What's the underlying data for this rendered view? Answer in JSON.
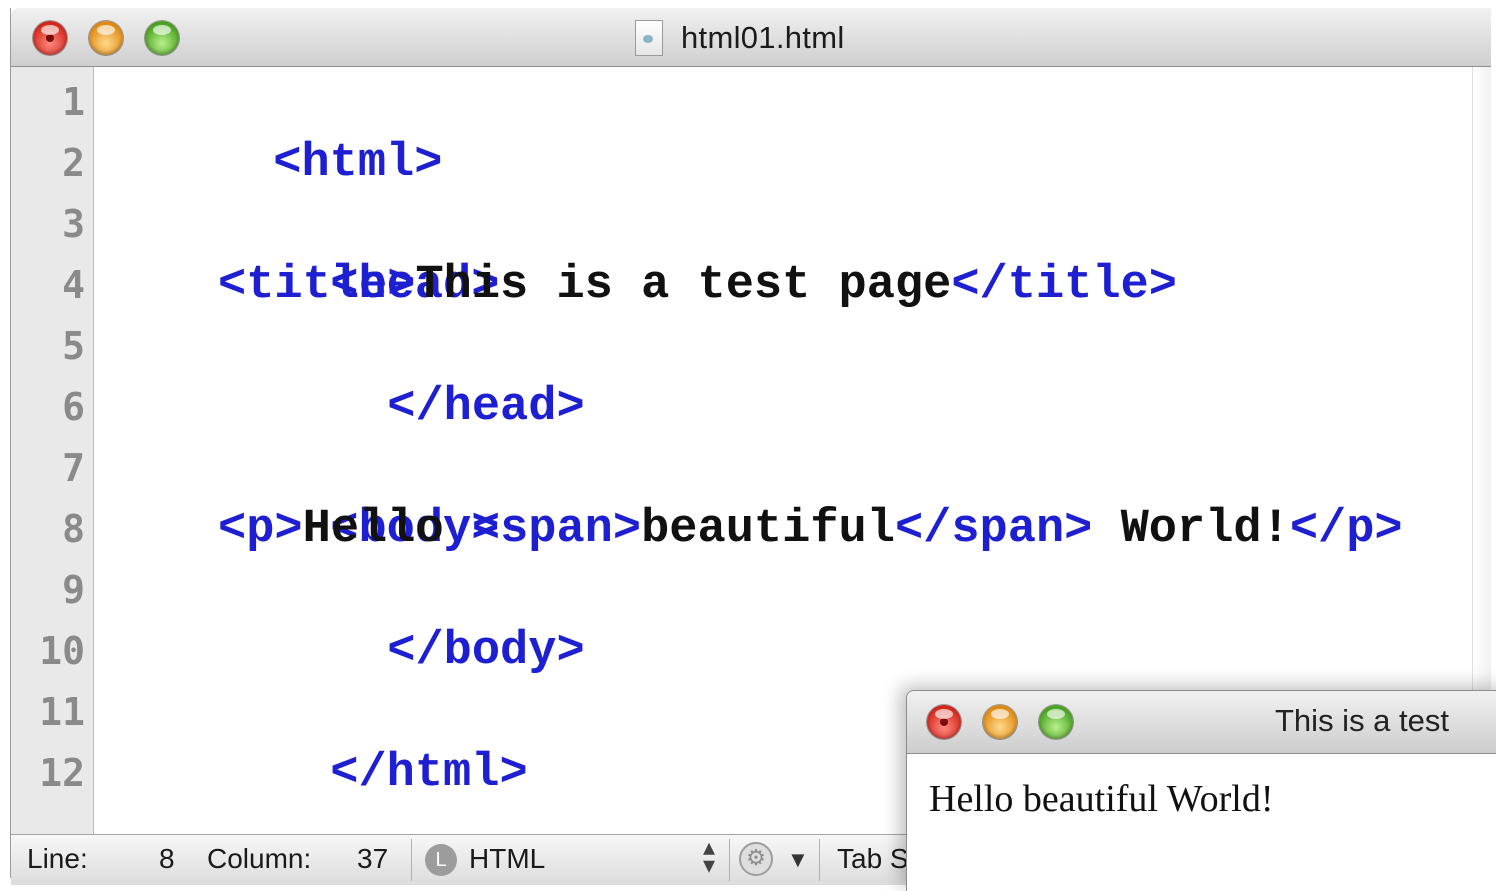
{
  "editor": {
    "title": "html01.html",
    "line_numbers": [
      "1",
      "2",
      "3",
      "4",
      "5",
      "6",
      "7",
      "8",
      "9",
      "10",
      "11",
      "12"
    ],
    "code": {
      "l1_tag": "<html>",
      "l3_tag": "<head>",
      "l4_open": "<title>",
      "l4_text": "This is a test page",
      "l4_close": "</title>",
      "l5_tag": "</head>",
      "l7_tag": "<body>",
      "l8_p_open": "<p>",
      "l8_text1": "Hello ",
      "l8_span_open": "<span>",
      "l8_text2": "beautiful",
      "l8_span_close": "</span>",
      "l8_text3": " World!",
      "l8_p_close": "</p>",
      "l9_tag": "</body>",
      "l11_tag": "</html>"
    },
    "colors": {
      "tag": "#1d1fd1",
      "text": "#111111",
      "gutter": "#e9e9e9"
    },
    "statusbar": {
      "line_label": "Line:",
      "line_value": "8",
      "column_label": "Column:",
      "column_value": "37",
      "language": "HTML",
      "language_icon": "L",
      "tab_label": "Tab S"
    }
  },
  "browser": {
    "title": "This is a test",
    "content": "Hello beautiful World!"
  }
}
